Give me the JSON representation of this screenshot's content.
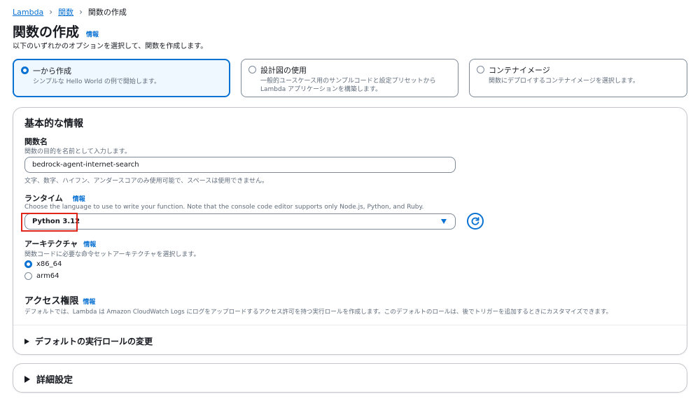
{
  "breadcrumb": {
    "root": "Lambda",
    "functions": "関数",
    "current": "関数の作成"
  },
  "page": {
    "title": "関数の作成",
    "info": "情報",
    "description": "以下のいずれかのオプションを選択して、関数を作成します。"
  },
  "options": [
    {
      "title": "一から作成",
      "desc1": "シンプルな Hello World の例で開始します。",
      "desc2": "",
      "selected": true
    },
    {
      "title": "設計図の使用",
      "desc1": "一般的ユースケース用のサンプルコードと設定プリセットから",
      "desc2": "Lambda アプリケーションを構築します。",
      "selected": false
    },
    {
      "title": "コンテナイメージ",
      "desc1": "関数にデプロイするコンテナイメージを選択します。",
      "desc2": "",
      "selected": false
    }
  ],
  "basic": {
    "title": "基本的な情報",
    "name_label": "関数名",
    "name_desc": "関数の目的を名前として入力します。",
    "name_value": "bedrock-agent-internet-search",
    "name_hint": "文字、数字、ハイフン、アンダースコアのみ使用可能で、スペースは使用できません。",
    "runtime_label": "ランタイム",
    "runtime_info": "情報",
    "runtime_desc": "Choose the language to use to write your function. Note that the console code editor supports only Node.js, Python, and Ruby.",
    "runtime_value": "Python 3.12",
    "arch_label": "アーキテクチャ",
    "arch_info": "情報",
    "arch_desc": "関数コードに必要な命令セットアーキテクチャを選択します。",
    "arch_options": [
      "x86_64",
      "arm64"
    ],
    "arch_selected": "x86_64",
    "access_title": "アクセス権限",
    "access_info": "情報",
    "access_desc": "デフォルトでは、Lambda は Amazon CloudWatch Logs にログをアップロードするアクセス許可を持つ実行ロールを作成します。このデフォルトのロールは、後でトリガーを追加するときにカスタマイズできます。",
    "role_expander": "デフォルトの実行ロールの変更"
  },
  "advanced": {
    "label": "詳細設定"
  },
  "colors": {
    "accent": "#0972d3",
    "highlight": "#e0251b"
  }
}
